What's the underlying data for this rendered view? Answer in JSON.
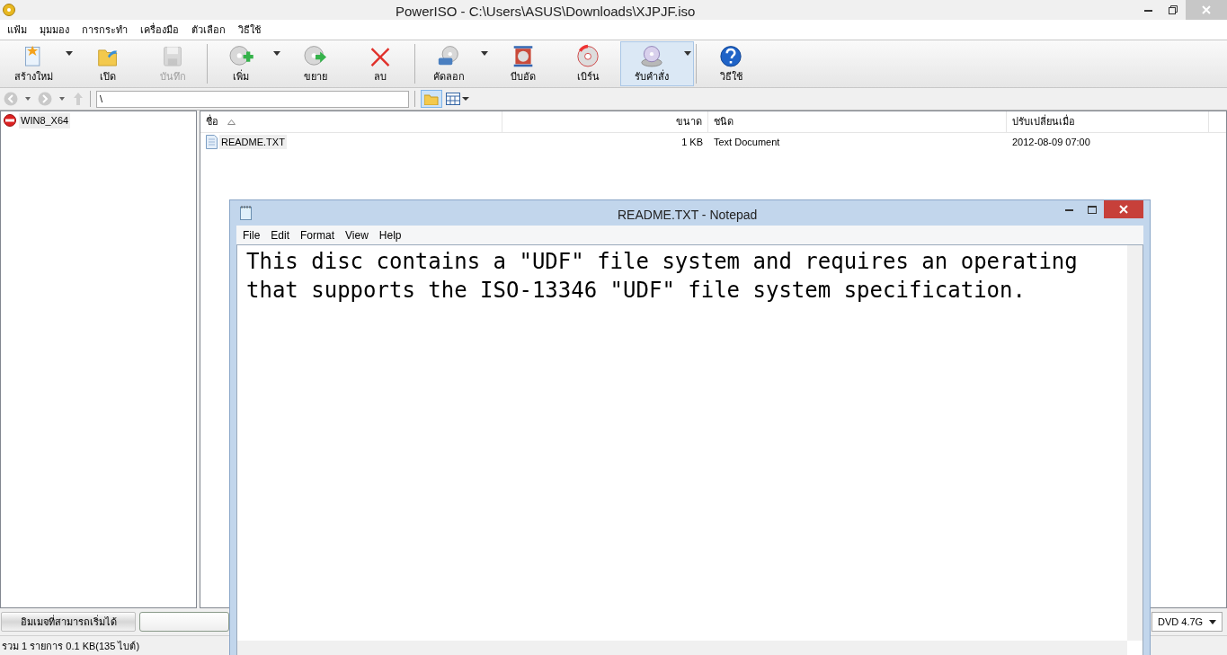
{
  "window": {
    "title": "PowerISO - C:\\Users\\ASUS\\Downloads\\XJPJF.iso"
  },
  "menu": [
    "แฟ้ม",
    "มุมมอง",
    "การกระทำ",
    "เครื่องมือ",
    "ตัวเลือก",
    "วิธีใช้"
  ],
  "toolbar": [
    {
      "kind": "new",
      "label": "สร้างใหม่",
      "dropdown": true,
      "disabled": false,
      "selected": false
    },
    {
      "kind": "open",
      "label": "เปิด",
      "dropdown": false,
      "disabled": false,
      "selected": false
    },
    {
      "kind": "save",
      "label": "บันทึก",
      "dropdown": false,
      "disabled": true,
      "selected": false
    },
    {
      "kind": "separator"
    },
    {
      "kind": "add",
      "label": "เพิ่ม",
      "dropdown": true,
      "disabled": false,
      "selected": false
    },
    {
      "kind": "extract",
      "label": "ขยาย",
      "dropdown": false,
      "disabled": false,
      "selected": false
    },
    {
      "kind": "delete",
      "label": "ลบ",
      "dropdown": false,
      "disabled": false,
      "selected": false
    },
    {
      "kind": "separator"
    },
    {
      "kind": "copy",
      "label": "คัดลอก",
      "dropdown": true,
      "disabled": false,
      "selected": false
    },
    {
      "kind": "compress",
      "label": "บีบอัด",
      "dropdown": false,
      "disabled": false,
      "selected": false
    },
    {
      "kind": "burn",
      "label": "เบิร์น",
      "dropdown": false,
      "disabled": false,
      "selected": false
    },
    {
      "kind": "mount",
      "label": "รับคำสั่ง",
      "dropdown": true,
      "disabled": false,
      "selected": true
    },
    {
      "kind": "separator"
    },
    {
      "kind": "help",
      "label": "วิธีใช้",
      "dropdown": false,
      "disabled": false,
      "selected": false
    }
  ],
  "address_bar": {
    "path": "\\"
  },
  "tree": [
    {
      "label": "WIN8_X64",
      "selected": true
    }
  ],
  "file_list": {
    "columns": [
      "ชื่อ",
      "ขนาด",
      "ชนิด",
      "ปรับเปลี่ยนเมื่อ"
    ],
    "rows": [
      {
        "name": "README.TXT",
        "size": "1 KB",
        "type": "Text Document",
        "modified": "2012-08-09 07:00",
        "selected": true
      }
    ]
  },
  "status": {
    "image_type": "อิมเมจที่สามารถเริ่มได้",
    "media": "DVD 4.7G",
    "summary": "รวม 1 รายการ 0.1 KB(135 ไบต์)"
  },
  "notepad": {
    "title": "README.TXT - Notepad",
    "menu": [
      "File",
      "Edit",
      "Format",
      "View",
      "Help"
    ],
    "lines": [
      "This disc contains a \"UDF\" file system and requires an operating",
      "that supports the ISO-13346 \"UDF\" file system specification."
    ]
  }
}
